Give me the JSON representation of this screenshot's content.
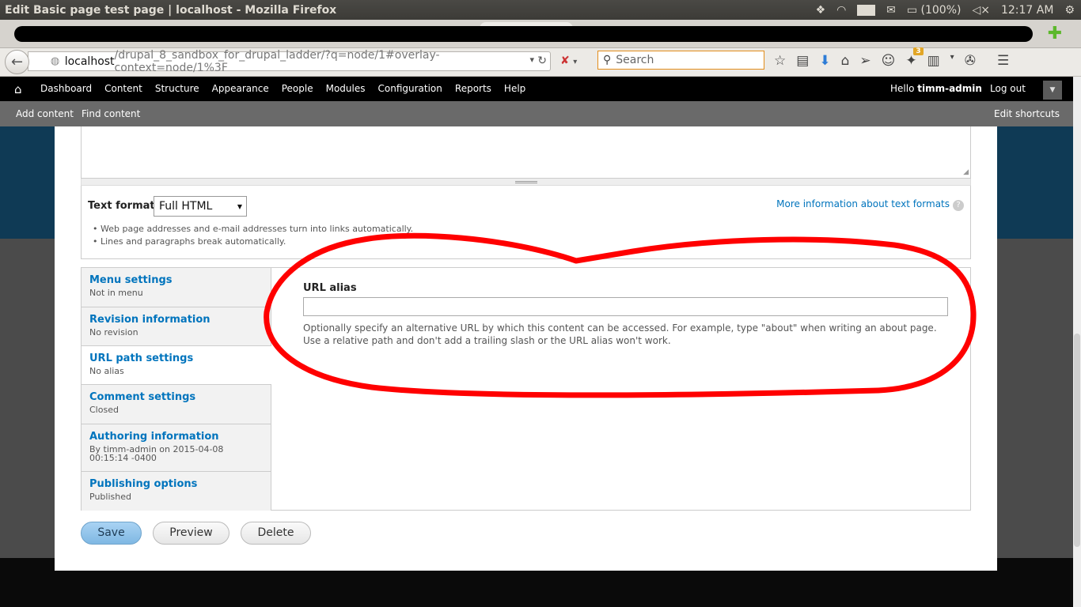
{
  "window": {
    "title": "Edit Basic page test page | localhost - Mozilla Firefox"
  },
  "tray": {
    "lang": "En",
    "battery": "(100%)",
    "clock": "12:17 AM"
  },
  "nav": {
    "url_host": "localhost",
    "url_path": "/drupal_8_sandbox_for_drupal_ladder/?q=node/1#overlay-context=node/1%3F",
    "search_placeholder": "Search",
    "notification_count": "3"
  },
  "toolbar": {
    "items": [
      "Dashboard",
      "Content",
      "Structure",
      "Appearance",
      "People",
      "Modules",
      "Configuration",
      "Reports",
      "Help"
    ],
    "hello_prefix": "Hello ",
    "user": "timm-admin",
    "logout": "Log out"
  },
  "shortcuts": {
    "add": "Add content",
    "find": "Find content",
    "edit": "Edit shortcuts"
  },
  "text_format": {
    "label": "Text format",
    "selected": "Full HTML",
    "more_link": "More information about text formats",
    "tips": [
      "Web page addresses and e-mail addresses turn into links automatically.",
      "Lines and paragraphs break automatically."
    ]
  },
  "vertical_tabs": [
    {
      "title": "Menu settings",
      "summary": "Not in menu"
    },
    {
      "title": "Revision information",
      "summary": "No revision"
    },
    {
      "title": "URL path settings",
      "summary": "No alias"
    },
    {
      "title": "Comment settings",
      "summary": "Closed"
    },
    {
      "title": "Authoring information",
      "summary": "By timm-admin on 2015-04-08 00:15:14 -0400"
    },
    {
      "title": "Publishing options",
      "summary": "Published"
    }
  ],
  "url_alias": {
    "label": "URL alias",
    "value": "",
    "description_1": "Optionally specify an alternative URL by which this content can be accessed. For example, type \"about\" when writing an about page.",
    "description_2": "Use a relative path and don't add a trailing slash or the URL alias won't work."
  },
  "actions": {
    "save": "Save",
    "preview": "Preview",
    "delete": "Delete"
  },
  "colors": {
    "link": "#0074bd",
    "annotation": "#ff0000",
    "toolbar": "#000000"
  }
}
